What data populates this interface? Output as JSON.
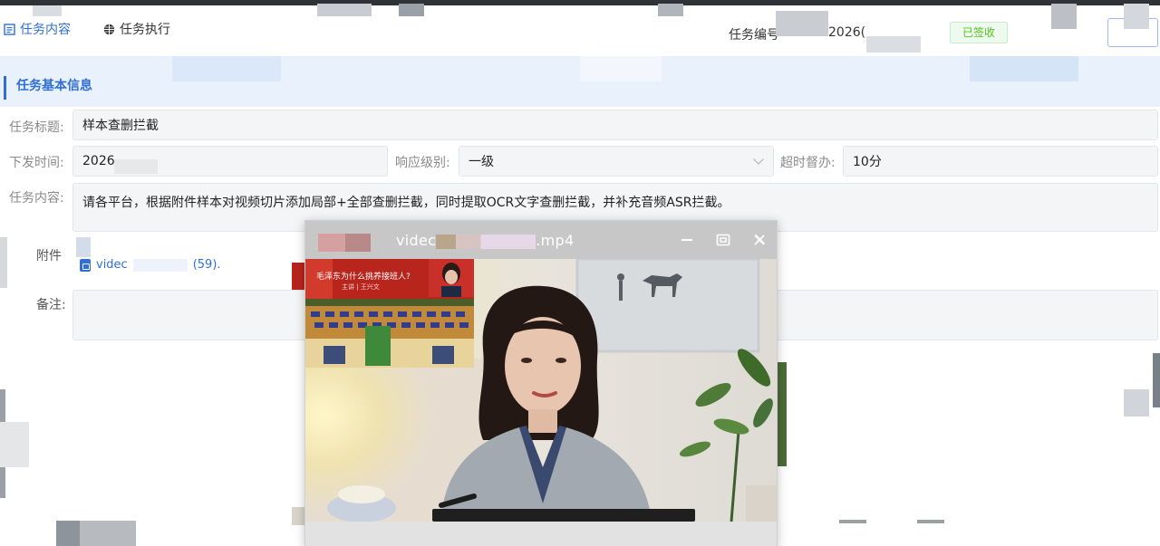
{
  "tabs": {
    "content": "任务内容",
    "execute": "任务执行"
  },
  "header": {
    "task_no_label": "任务编号",
    "task_no_value": "2026(",
    "status": "已签收"
  },
  "section": {
    "title": "任务基本信息"
  },
  "form": {
    "title_label": "任务标题:",
    "title_value": "样本查删拦截",
    "time_label": "下发时间:",
    "time_value": "2026",
    "level_label": "响应级别:",
    "level_value": "一级",
    "timeout_label": "超时督办:",
    "timeout_value": "10分",
    "content_label": "任务内容:",
    "content_value": "请各平台，根据附件样本对视频切片添加局部+全部查删拦截，同时提取OCR文字查删拦截，并补充音频ASR拦截。",
    "attach_label": "附件",
    "attach_name": "videc",
    "attach_suffix": "(59).",
    "remark_label": "备注:",
    "remark_value": ""
  },
  "player": {
    "title_prefix": "videc",
    "title_suffix": ".mp4",
    "inset_caption": "毛泽东为什么挑养接班人?",
    "inset_sub": "主讲 | 王兴文"
  },
  "colors": {
    "accent": "#2f6fd6",
    "status_green": "#52c41a",
    "section_bg": "#e9f1fc"
  }
}
